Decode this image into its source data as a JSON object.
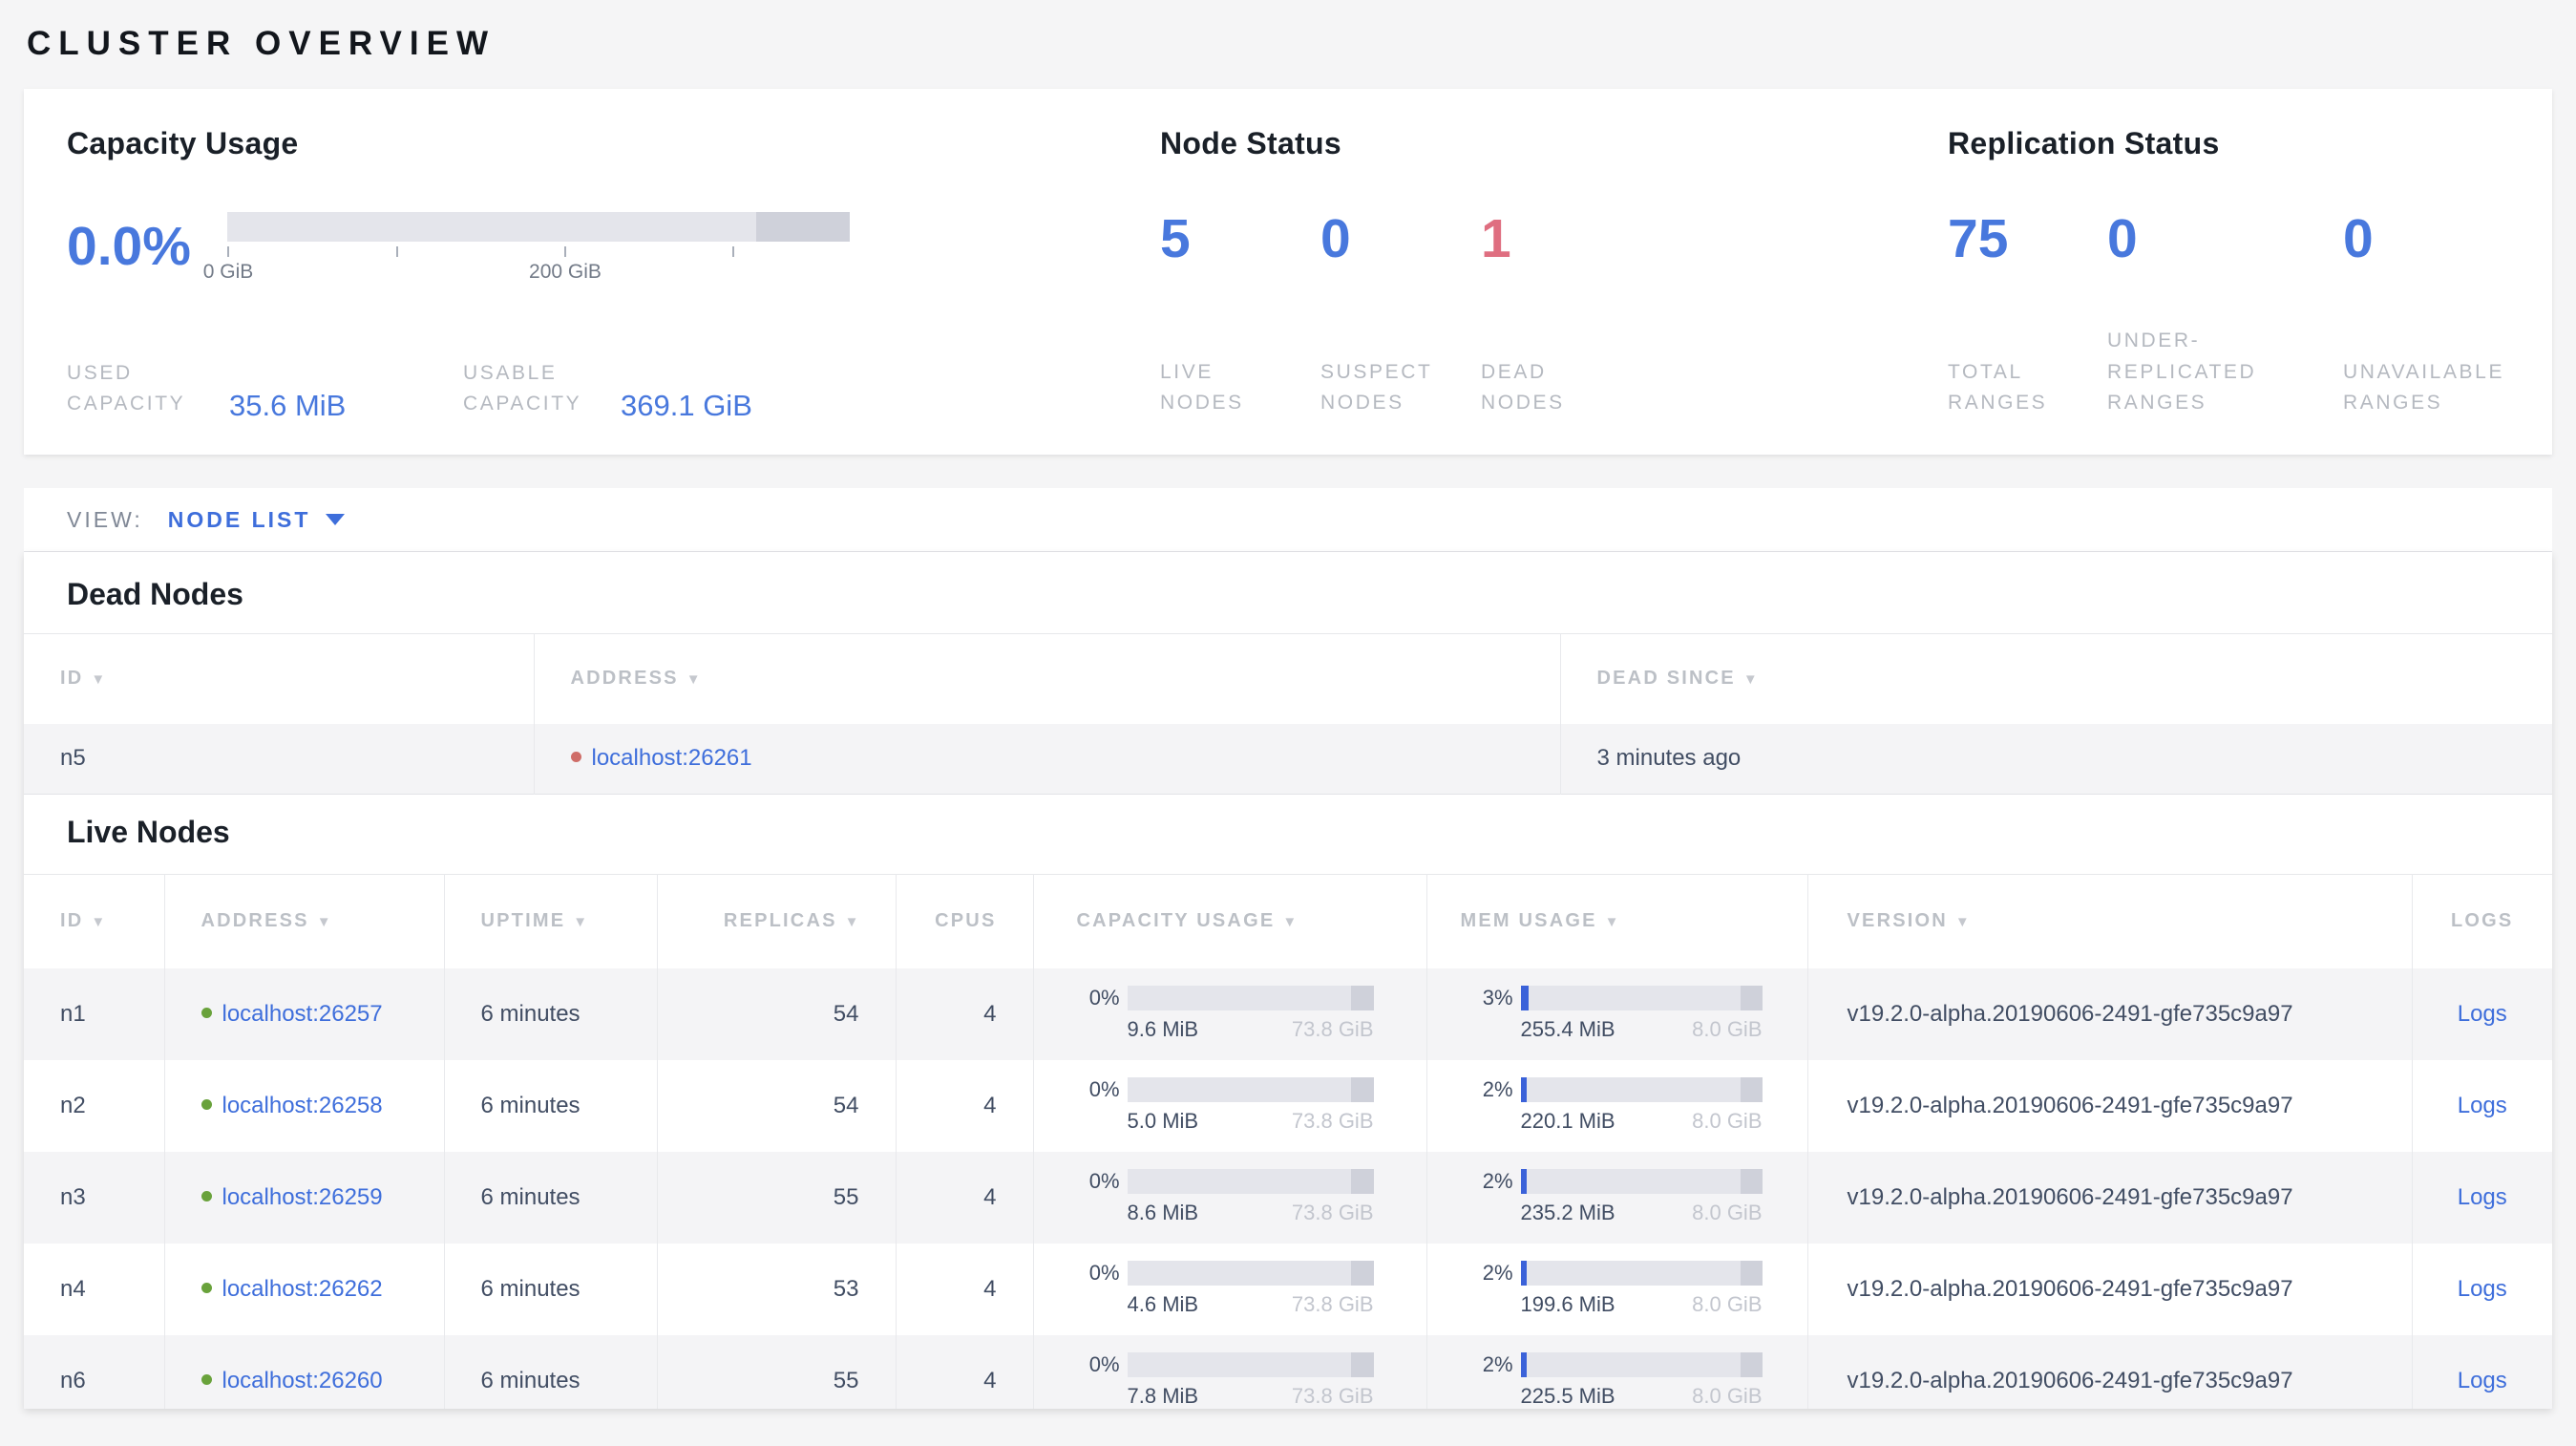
{
  "page_title": "CLUSTER OVERVIEW",
  "colors": {
    "accent_blue": "#4878dd",
    "link_blue": "#3e6edb",
    "danger_red": "#df6e80",
    "live_dot_green": "#69a23b",
    "dead_dot_red": "#cf6d68",
    "bar_track": "#e4e5eb",
    "bar_dark_segment": "#cfd1da",
    "bar_fill_blue": "#3b62d9"
  },
  "summary": {
    "capacity": {
      "heading": "Capacity Usage",
      "percent": "0.0%",
      "tick_labels": [
        "0 GiB",
        "200 GiB"
      ],
      "stats": [
        {
          "label_lines": [
            "USED",
            "CAPACITY"
          ],
          "value": "35.6 MiB"
        },
        {
          "label_lines": [
            "USABLE",
            "CAPACITY"
          ],
          "value": "369.1 GiB"
        }
      ]
    },
    "node_status": {
      "heading": "Node Status",
      "stats": [
        {
          "value": "5",
          "label_lines": [
            "LIVE",
            "NODES"
          ]
        },
        {
          "value": "0",
          "label_lines": [
            "SUSPECT",
            "NODES"
          ]
        },
        {
          "value": "1",
          "label_lines": [
            "DEAD",
            "NODES"
          ]
        }
      ]
    },
    "replication": {
      "heading": "Replication Status",
      "stats": [
        {
          "value": "75",
          "label_lines": [
            "TOTAL",
            "RANGES"
          ]
        },
        {
          "value": "0",
          "label_lines": [
            "UNDER-",
            "REPLICATED",
            "RANGES"
          ]
        },
        {
          "value": "0",
          "label_lines": [
            "UNAVAILABLE",
            "RANGES"
          ]
        }
      ]
    }
  },
  "view_bar": {
    "label": "VIEW:",
    "selected": "NODE LIST"
  },
  "dead_nodes": {
    "heading": "Dead Nodes",
    "columns": [
      "ID",
      "ADDRESS",
      "DEAD SINCE"
    ],
    "rows": [
      {
        "id": "n5",
        "address": "localhost:26261",
        "dead_since": "3 minutes ago"
      }
    ]
  },
  "live_nodes": {
    "heading": "Live Nodes",
    "columns": [
      "ID",
      "ADDRESS",
      "UPTIME",
      "REPLICAS",
      "CPUS",
      "CAPACITY USAGE",
      "MEM USAGE",
      "VERSION",
      "LOGS"
    ],
    "rows": [
      {
        "id": "n1",
        "address": "localhost:26257",
        "uptime": "6 minutes",
        "replicas": "54",
        "cpus": "4",
        "capacity": {
          "percent": "0%",
          "used": "9.6 MiB",
          "total": "73.8 GiB"
        },
        "memory": {
          "percent": "3%",
          "used": "255.4 MiB",
          "total": "8.0 GiB"
        },
        "version": "v19.2.0-alpha.20190606-2491-gfe735c9a97",
        "logs_label": "Logs"
      },
      {
        "id": "n2",
        "address": "localhost:26258",
        "uptime": "6 minutes",
        "replicas": "54",
        "cpus": "4",
        "capacity": {
          "percent": "0%",
          "used": "5.0 MiB",
          "total": "73.8 GiB"
        },
        "memory": {
          "percent": "2%",
          "used": "220.1 MiB",
          "total": "8.0 GiB"
        },
        "version": "v19.2.0-alpha.20190606-2491-gfe735c9a97",
        "logs_label": "Logs"
      },
      {
        "id": "n3",
        "address": "localhost:26259",
        "uptime": "6 minutes",
        "replicas": "55",
        "cpus": "4",
        "capacity": {
          "percent": "0%",
          "used": "8.6 MiB",
          "total": "73.8 GiB"
        },
        "memory": {
          "percent": "2%",
          "used": "235.2 MiB",
          "total": "8.0 GiB"
        },
        "version": "v19.2.0-alpha.20190606-2491-gfe735c9a97",
        "logs_label": "Logs"
      },
      {
        "id": "n4",
        "address": "localhost:26262",
        "uptime": "6 minutes",
        "replicas": "53",
        "cpus": "4",
        "capacity": {
          "percent": "0%",
          "used": "4.6 MiB",
          "total": "73.8 GiB"
        },
        "memory": {
          "percent": "2%",
          "used": "199.6 MiB",
          "total": "8.0 GiB"
        },
        "version": "v19.2.0-alpha.20190606-2491-gfe735c9a97",
        "logs_label": "Logs"
      },
      {
        "id": "n6",
        "address": "localhost:26260",
        "uptime": "6 minutes",
        "replicas": "55",
        "cpus": "4",
        "capacity": {
          "percent": "0%",
          "used": "7.8 MiB",
          "total": "73.8 GiB"
        },
        "memory": {
          "percent": "2%",
          "used": "225.5 MiB",
          "total": "8.0 GiB"
        },
        "version": "v19.2.0-alpha.20190606-2491-gfe735c9a97",
        "logs_label": "Logs"
      }
    ]
  }
}
